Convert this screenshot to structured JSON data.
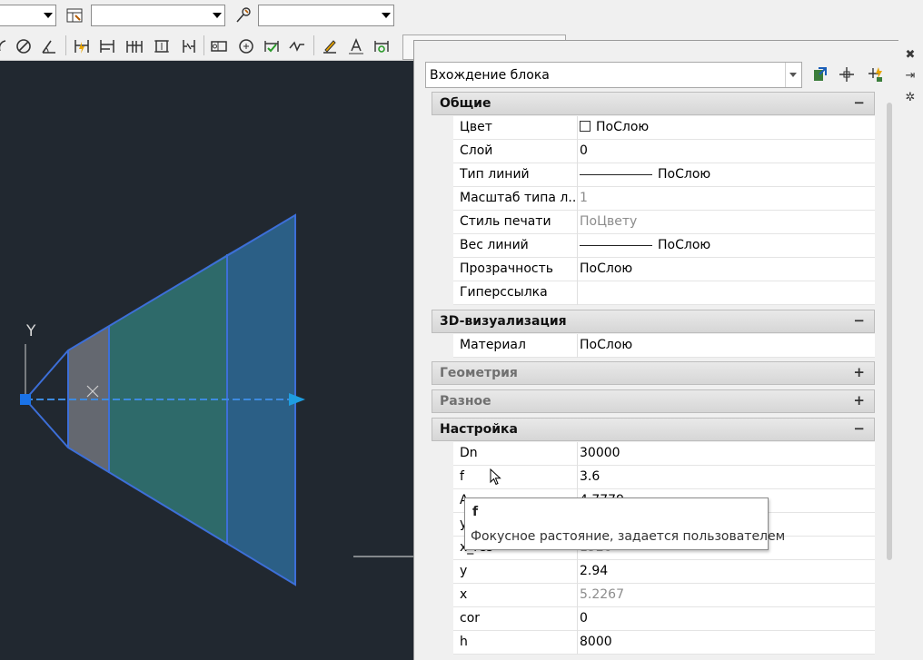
{
  "toolbar": {
    "combo1_value": "",
    "combo2_value": "",
    "combo3_value": ""
  },
  "palette": {
    "object_selector": "Вхождение блока",
    "icons": [
      "toggle-pickadd-icon",
      "select-objects-icon",
      "quick-select-icon"
    ],
    "side_icons": [
      "close-icon",
      "auto-hide-icon",
      "properties-menu-icon"
    ]
  },
  "categories": [
    {
      "label": "Общие",
      "toggle": "−",
      "expanded": true,
      "rows": [
        {
          "name": "Цвет",
          "value": "ПоСлою"
        },
        {
          "name": "Слой",
          "value": "0"
        },
        {
          "name": "Тип линий",
          "value": "ПоСлою"
        },
        {
          "name": "Масштаб типа л...",
          "value": "1"
        },
        {
          "name": "Стиль печати",
          "value": "ПоЦвету"
        },
        {
          "name": "Вес линий",
          "value": "ПоСлою"
        },
        {
          "name": "Прозрачность",
          "value": "ПоСлою"
        },
        {
          "name": "Гиперссылка",
          "value": ""
        }
      ]
    },
    {
      "label": "3D-визуализация",
      "toggle": "−",
      "expanded": true,
      "rows": [
        {
          "name": "Материал",
          "value": "ПоСлою"
        }
      ]
    },
    {
      "label": "Геометрия",
      "toggle": "+",
      "expanded": false,
      "rows": []
    },
    {
      "label": "Разное",
      "toggle": "+",
      "expanded": false,
      "rows": []
    },
    {
      "label": "Настройка",
      "toggle": "−",
      "expanded": true,
      "rows": [
        {
          "name": "Dn",
          "value": "30000"
        },
        {
          "name": "f",
          "value": "3.6"
        },
        {
          "name": "A",
          "value": "4.7779"
        },
        {
          "name": "y",
          "value": ""
        },
        {
          "name": "x_res",
          "value": "1920"
        },
        {
          "name": "y",
          "value": "2.94"
        },
        {
          "name": "x",
          "value": "5.2267"
        },
        {
          "name": "cor",
          "value": "0"
        },
        {
          "name": "h",
          "value": "8000"
        }
      ]
    }
  ],
  "tooltip": {
    "title": "f",
    "body": "Фокусное растояние, задается пользователем"
  },
  "canvas": {
    "ucs_y_label": "Y",
    "colors": {
      "background": "#212830",
      "fill_gray": "#6b6f78",
      "fill_green": "#2e6a6a",
      "fill_blue": "#2b5f86",
      "outline": "#3d6fd8",
      "axis_arrow": "#1e9de0"
    }
  }
}
